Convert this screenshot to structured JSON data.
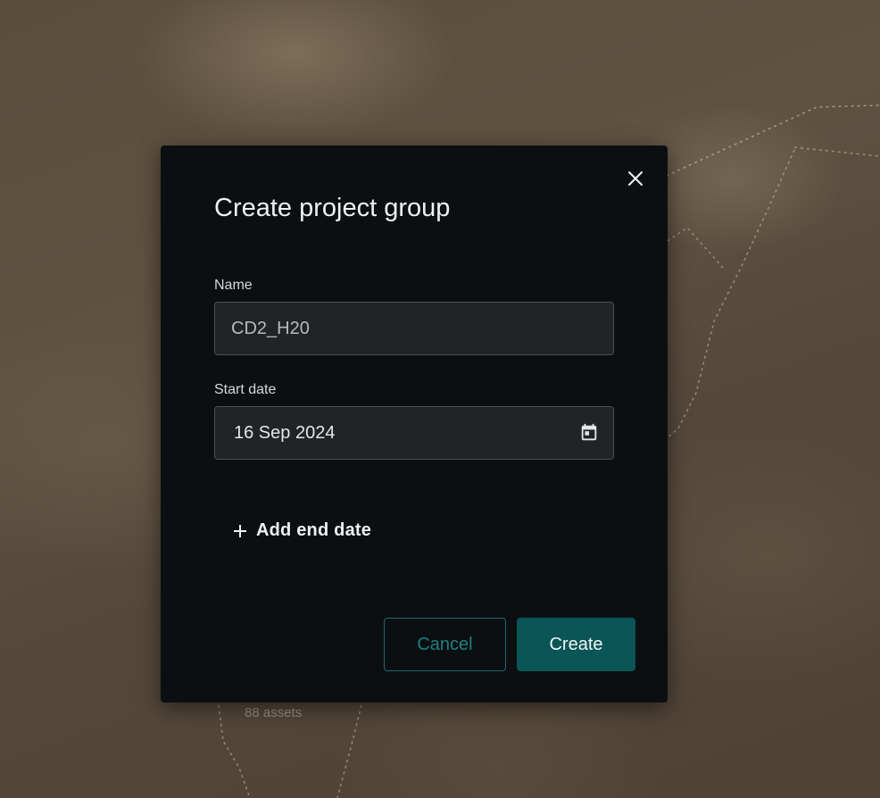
{
  "background": {
    "map_label": "88 assets"
  },
  "dialog": {
    "title": "Create project group",
    "close_icon": "close-icon",
    "name_field": {
      "label": "Name",
      "value": "CD2_H20"
    },
    "start_date_field": {
      "label": "Start date",
      "value": "16 Sep 2024",
      "icon": "calendar-icon"
    },
    "add_end_date": {
      "icon": "plus-icon",
      "label": "Add end date"
    },
    "buttons": {
      "cancel_label": "Cancel",
      "create_label": "Create"
    }
  },
  "colors": {
    "dialog_bg": "#0b0f11",
    "input_bg": "#202427",
    "input_border": "#4a5054",
    "accent": "#0a5556",
    "cancel_text": "#1f7f82"
  }
}
